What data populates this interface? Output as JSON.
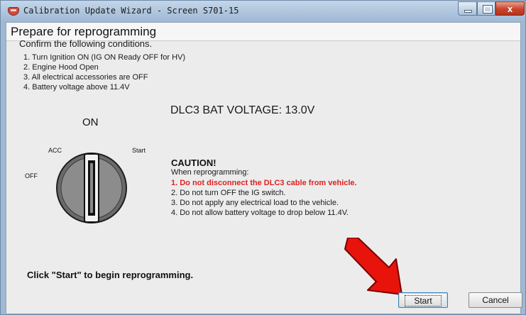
{
  "window": {
    "title": "Calibration Update Wizard - Screen S701-15",
    "controls": {
      "minimize": "minimize",
      "maximize": "maximize",
      "close": "x"
    }
  },
  "page": {
    "title": "Prepare for reprogramming"
  },
  "conditions": {
    "heading": "Confirm the following conditions.",
    "items": [
      "1. Turn Ignition ON (IG ON Ready OFF for HV)",
      "2. Engine Hood Open",
      "3. All electrical accessories are OFF",
      "4. Battery voltage above 11.4V"
    ]
  },
  "voltage_readout": "DLC3 BAT VOLTAGE: 13.0V",
  "ignition_switch": {
    "labels": {
      "on": "ON",
      "acc": "ACC",
      "off": "OFF",
      "start": "Start"
    }
  },
  "caution": {
    "title": "CAUTION!",
    "subtitle": "When reprogramming:",
    "items": [
      "1. Do not disconnect the DLC3 cable from vehicle.",
      "2. Do not turn OFF the IG switch.",
      "3. Do not apply any electrical load to the vehicle.",
      "4. Do not allow battery voltage to drop below 11.4V."
    ],
    "warning_color": "#e02020"
  },
  "footer": {
    "hint": "Click \"Start\" to begin reprogramming.",
    "start_label": "Start",
    "cancel_label": "Cancel"
  },
  "annotation": {
    "arrow_color": "#e8140c"
  }
}
